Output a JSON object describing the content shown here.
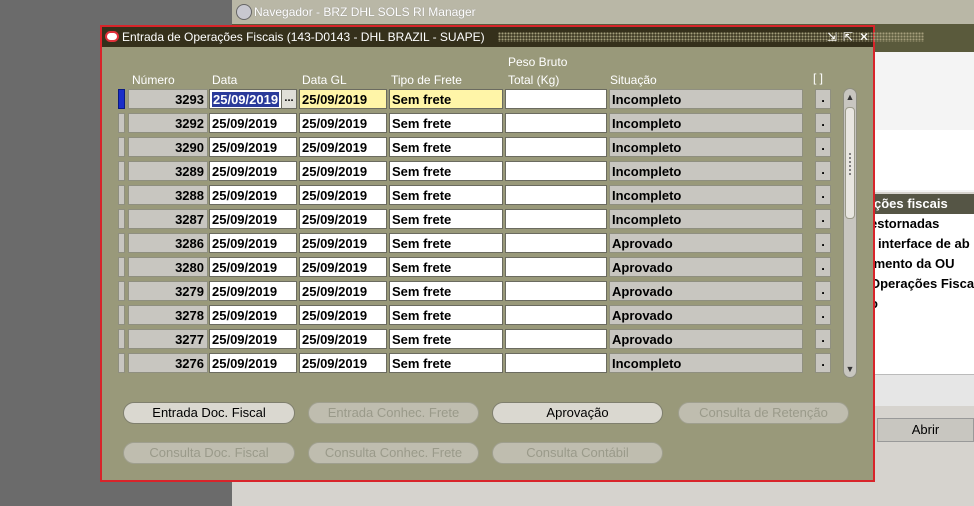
{
  "background_window": {
    "title": "Navegador - BRZ DHL SOLS RI Manager",
    "section_title": "ções fiscais",
    "list_items": [
      "estornadas",
      "- interface de ab",
      "imento da OU",
      "Operações Fisca",
      "o"
    ],
    "abrir_label": "Abrir"
  },
  "window": {
    "title": "Entrada de Operações Fiscais (143-D0143 - DHL BRAZIL - SUAPE)",
    "controls": {
      "minimize": "⇲",
      "maximize": "⇱",
      "close": "✕"
    }
  },
  "columns": {
    "numero": "Número",
    "data": "Data",
    "data_gl": "Data GL",
    "tipo_frete": "Tipo de Frete",
    "peso_line1": "Peso Bruto",
    "peso_line2": "Total (Kg)",
    "situacao": "Situação",
    "brackets": "[ ]"
  },
  "rows": [
    {
      "numero": "3293",
      "data": "25/09/2019",
      "data_gl": "25/09/2019",
      "tipo_frete": "Sem frete",
      "peso": "",
      "situacao": "Incompleto",
      "dot": "."
    },
    {
      "numero": "3292",
      "data": "25/09/2019",
      "data_gl": "25/09/2019",
      "tipo_frete": "Sem frete",
      "peso": "",
      "situacao": "Incompleto",
      "dot": "."
    },
    {
      "numero": "3290",
      "data": "25/09/2019",
      "data_gl": "25/09/2019",
      "tipo_frete": "Sem frete",
      "peso": "",
      "situacao": "Incompleto",
      "dot": "."
    },
    {
      "numero": "3289",
      "data": "25/09/2019",
      "data_gl": "25/09/2019",
      "tipo_frete": "Sem frete",
      "peso": "",
      "situacao": "Incompleto",
      "dot": "."
    },
    {
      "numero": "3288",
      "data": "25/09/2019",
      "data_gl": "25/09/2019",
      "tipo_frete": "Sem frete",
      "peso": "",
      "situacao": "Incompleto",
      "dot": "."
    },
    {
      "numero": "3287",
      "data": "25/09/2019",
      "data_gl": "25/09/2019",
      "tipo_frete": "Sem frete",
      "peso": "",
      "situacao": "Incompleto",
      "dot": "."
    },
    {
      "numero": "3286",
      "data": "25/09/2019",
      "data_gl": "25/09/2019",
      "tipo_frete": "Sem frete",
      "peso": "",
      "situacao": "Aprovado",
      "dot": "."
    },
    {
      "numero": "3280",
      "data": "25/09/2019",
      "data_gl": "25/09/2019",
      "tipo_frete": "Sem frete",
      "peso": "",
      "situacao": "Aprovado",
      "dot": "."
    },
    {
      "numero": "3279",
      "data": "25/09/2019",
      "data_gl": "25/09/2019",
      "tipo_frete": "Sem frete",
      "peso": "",
      "situacao": "Aprovado",
      "dot": "."
    },
    {
      "numero": "3278",
      "data": "25/09/2019",
      "data_gl": "25/09/2019",
      "tipo_frete": "Sem frete",
      "peso": "",
      "situacao": "Aprovado",
      "dot": "."
    },
    {
      "numero": "3277",
      "data": "25/09/2019",
      "data_gl": "25/09/2019",
      "tipo_frete": "Sem frete",
      "peso": "",
      "situacao": "Aprovado",
      "dot": "."
    },
    {
      "numero": "3276",
      "data": "25/09/2019",
      "data_gl": "25/09/2019",
      "tipo_frete": "Sem frete",
      "peso": "",
      "situacao": "Incompleto",
      "dot": "."
    }
  ],
  "lov_label": "...",
  "buttons": {
    "entrada_doc_fiscal": "Entrada Doc. Fiscal",
    "entrada_conhec_frete": "Entrada Conhec. Frete",
    "aprovacao": "Aprovação",
    "consulta_retencao": "Consulta de Retenção",
    "consulta_doc_fiscal": "Consulta Doc. Fiscal",
    "consulta_conhec_frete": "Consulta Conhec. Frete",
    "consulta_contabil": "Consulta Contábil"
  },
  "colors": {
    "window_bg": "#99997a",
    "title_bg": "#35301b",
    "border": "#d8242a",
    "current_field": "#fff5a8",
    "selection": "#2a3a9a"
  }
}
